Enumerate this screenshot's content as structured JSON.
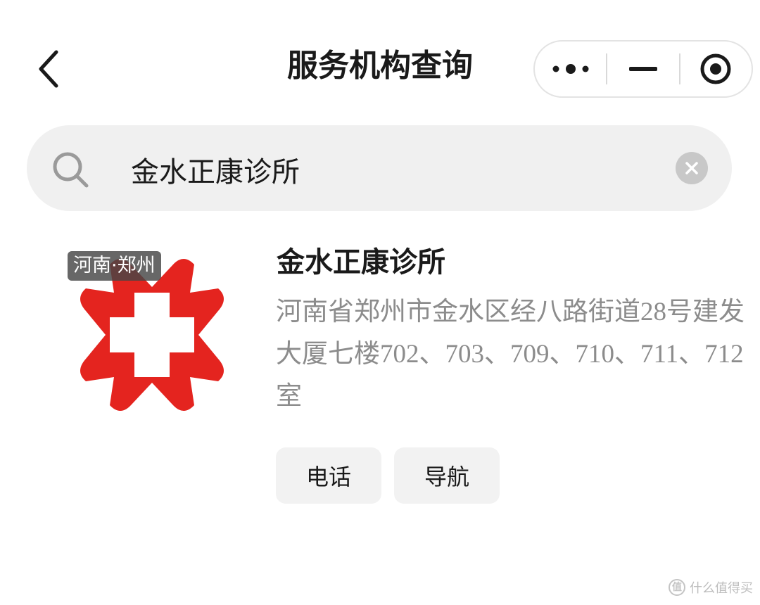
{
  "header": {
    "title": "服务机构查询",
    "back_icon": "chevron-left-icon",
    "capsule": {
      "more_icon": "more-dots-icon",
      "minimize_icon": "minimize-icon",
      "close_icon": "target-close-icon"
    }
  },
  "search": {
    "icon": "search-icon",
    "value": "金水正康诊所",
    "clear_icon": "clear-icon"
  },
  "results": [
    {
      "logo_icon": "red-cross-clinic-logo",
      "region_tag": "河南·郑州",
      "name": "金水正康诊所",
      "address": "河南省郑州市金水区经八路街道28号建发大厦七楼702、703、709、710、711、712室",
      "phone_label": "电话",
      "nav_label": "导航"
    }
  ],
  "watermark": {
    "badge": "值",
    "text": "什么值得买"
  },
  "colors": {
    "logo_red": "#e4241f",
    "address_gray": "#8c8c8c",
    "search_bg": "#f0f0f0",
    "button_bg": "#f2f2f2"
  }
}
